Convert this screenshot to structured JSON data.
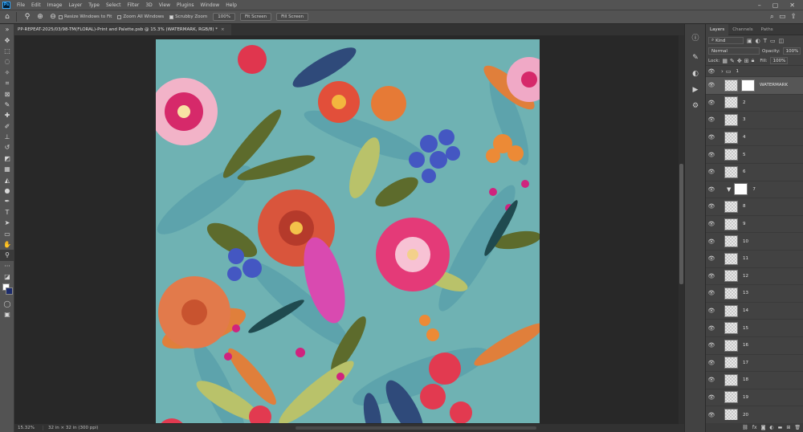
{
  "menubar": {
    "logo": "Ps",
    "items": [
      "File",
      "Edit",
      "Image",
      "Layer",
      "Type",
      "Select",
      "Filter",
      "3D",
      "View",
      "Plugins",
      "Window",
      "Help"
    ],
    "controls": [
      "–",
      "▢",
      "✕"
    ]
  },
  "options": {
    "checks": [
      {
        "label": "Resize Windows to Fit",
        "checked": false
      },
      {
        "label": "Zoom All Windows",
        "checked": false
      },
      {
        "label": "Scrubby Zoom",
        "checked": true
      }
    ],
    "buttons": [
      "100%",
      "Fit Screen",
      "Fill Screen"
    ]
  },
  "document": {
    "tab_title": "PP-REPEAT-2025/03/98-TM(FLORAL)-Print and Palette.psb @ 15.3% (WATERMARK, RGB/8) *",
    "close": "×"
  },
  "status": {
    "zoom": "15.32%",
    "info": "32 in × 32 in (300 ppi)"
  },
  "layers_panel": {
    "tabs": [
      "Layers",
      "Channels",
      "Paths"
    ],
    "filter": "Kind",
    "blend_mode": "Normal",
    "opacity_label": "Opacity:",
    "opacity": "100%",
    "lock_label": "Lock:",
    "fill_label": "Fill:",
    "fill": "100%",
    "layers": [
      {
        "name": "1",
        "type": "group",
        "visible": true
      },
      {
        "name": "WATERMARK",
        "type": "masked",
        "visible": true,
        "selected": true
      },
      {
        "name": "2",
        "type": "pixel",
        "visible": true
      },
      {
        "name": "3",
        "type": "pixel",
        "visible": true
      },
      {
        "name": "4",
        "type": "pixel",
        "visible": true
      },
      {
        "name": "5",
        "type": "pixel",
        "visible": true
      },
      {
        "name": "6",
        "type": "pixel",
        "visible": true
      },
      {
        "name": "7",
        "type": "adjustment",
        "visible": true
      },
      {
        "name": "8",
        "type": "pixel",
        "visible": true
      },
      {
        "name": "9",
        "type": "pixel",
        "visible": true
      },
      {
        "name": "10",
        "type": "pixel",
        "visible": true
      },
      {
        "name": "11",
        "type": "pixel",
        "visible": true
      },
      {
        "name": "12",
        "type": "pixel",
        "visible": true
      },
      {
        "name": "13",
        "type": "pixel",
        "visible": true
      },
      {
        "name": "14",
        "type": "pixel",
        "visible": true
      },
      {
        "name": "15",
        "type": "pixel",
        "visible": true
      },
      {
        "name": "16",
        "type": "pixel",
        "visible": true
      },
      {
        "name": "17",
        "type": "pixel",
        "visible": true
      },
      {
        "name": "18",
        "type": "pixel",
        "visible": true
      },
      {
        "name": "19",
        "type": "pixel",
        "visible": true
      },
      {
        "name": "20",
        "type": "pixel",
        "visible": true
      }
    ]
  },
  "colors": {
    "canvas_bg": "#6fb2b3",
    "ui_dark": "#282828",
    "ui_panel": "#424242",
    "accent": "#31a8ff"
  }
}
